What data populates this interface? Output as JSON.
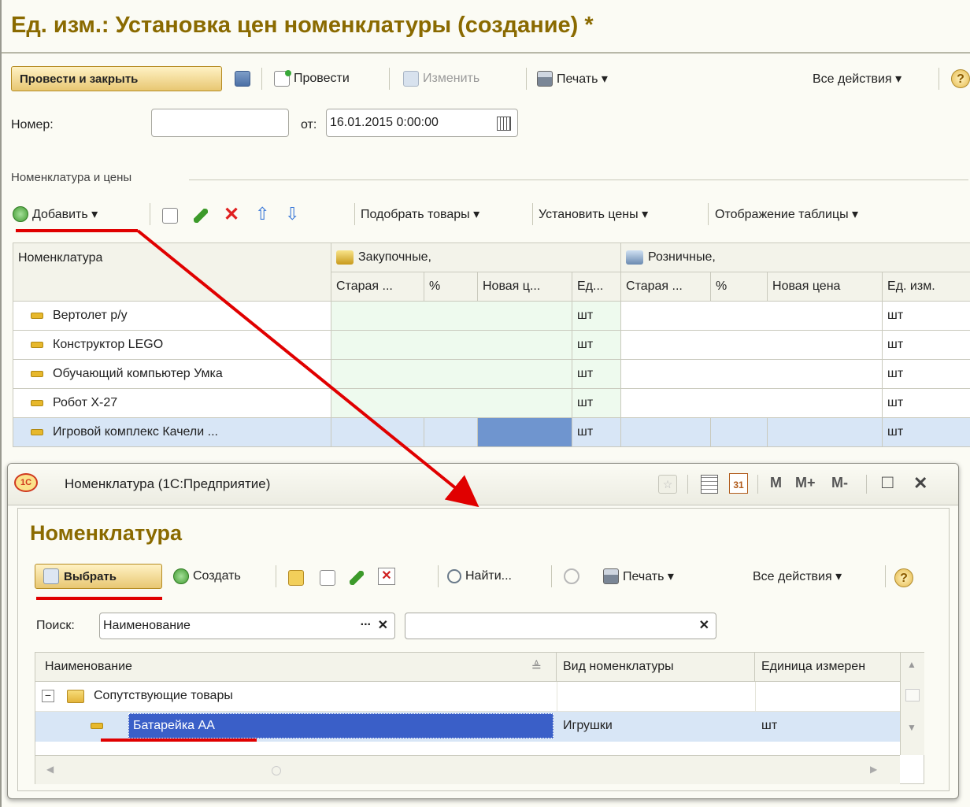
{
  "main": {
    "title": "Ед. изм.: Установка цен номенклатуры (создание) *",
    "toolbar": {
      "post_close": "Провести и закрыть",
      "post": "Провести",
      "change": "Изменить",
      "print": "Печать ▾",
      "all_actions": "Все действия ▾",
      "help": "?"
    },
    "number_label": "Номер:",
    "number_value": "",
    "from_label": "от:",
    "date_value": "16.01.2015  0:00:00",
    "group_label": "Номенклатура и цены",
    "table_toolbar": {
      "add": "Добавить ▾",
      "pick": "Подобрать товары ▾",
      "set_prices": "Установить цены ▾",
      "display": "Отображение таблицы ▾"
    },
    "table": {
      "col_nomenclature": "Номенклатура",
      "group_purchase": "Закупочные,",
      "group_retail": "Розничные,",
      "sub_headers": [
        "Старая ...",
        "%",
        "Новая ц...",
        "Ед...",
        "Старая ...",
        "%",
        "Новая цена",
        "Ед. изм."
      ],
      "rows": [
        {
          "name": "Вертолет р/у",
          "unit1": "шт",
          "unit2": "шт"
        },
        {
          "name": "Конструктор LEGO",
          "unit1": "шт",
          "unit2": "шт"
        },
        {
          "name": "Обучающий компьютер Умка",
          "unit1": "шт",
          "unit2": "шт"
        },
        {
          "name": "Робот Х-27",
          "unit1": "шт",
          "unit2": "шт"
        },
        {
          "name": "Игровой комплекс Качели ...",
          "unit1": "шт",
          "unit2": "шт"
        }
      ]
    }
  },
  "popup": {
    "window_title": "Номенклатура  (1С:Предприятие)",
    "app_logo": "1С",
    "titlebar_buttons": {
      "m": "M",
      "mplus": "M+",
      "mminus": "M-",
      "maximize": "□",
      "close": "✕"
    },
    "heading": "Номенклатура",
    "toolbar": {
      "select": "Выбрать",
      "create": "Создать",
      "find": "Найти...",
      "print": "Печать ▾",
      "all_actions": "Все действия ▾",
      "help": "?"
    },
    "search_label": "Поиск:",
    "search_field": "Наименование",
    "search_field_btn": "...",
    "clear": "✕",
    "search_value": "",
    "list": {
      "col_name": "Наименование",
      "col_kind": "Вид номенклатуры",
      "col_unit": "Единица измерен",
      "rows": [
        {
          "name": "Сопутствующие товары",
          "kind": "",
          "unit": "",
          "type": "folder",
          "toggle": "−"
        },
        {
          "name": "Батарейка АА",
          "kind": "Игрушки",
          "unit": "шт",
          "type": "item"
        }
      ]
    }
  },
  "colors": {
    "title": "#8a6a00",
    "annotation_red": "#e00000",
    "selection": "#d8e6f6",
    "selected_cell": "#6f95cf"
  }
}
